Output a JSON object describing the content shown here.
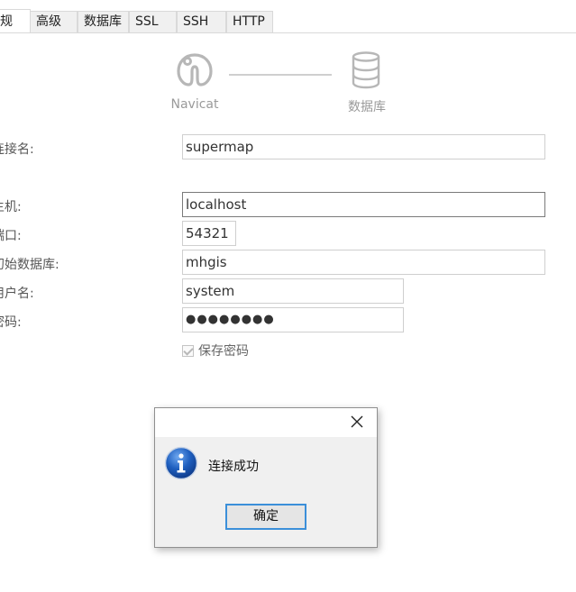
{
  "tabs": [
    {
      "label": "规"
    },
    {
      "label": "高级"
    },
    {
      "label": "数据库"
    },
    {
      "label": "SSL"
    },
    {
      "label": "SSH"
    },
    {
      "label": "HTTP"
    }
  ],
  "stepper": {
    "left_label": "Navicat",
    "right_label": "数据库"
  },
  "form": {
    "connection_name": {
      "label": "连接名:",
      "value": "supermap"
    },
    "host": {
      "label": "主机:",
      "value": "localhost"
    },
    "port": {
      "label": "端口:",
      "value": "54321"
    },
    "initial_database": {
      "label": "初始数据库:",
      "value": "mhgis"
    },
    "username": {
      "label": "用户名:",
      "value": "system"
    },
    "password": {
      "label": "密码:",
      "value": "●●●●●●●●"
    },
    "save_password": {
      "label": "保存密码",
      "checked": true
    }
  },
  "dialog": {
    "message": "连接成功",
    "ok_label": "确定",
    "icon": "info-icon"
  },
  "colors": {
    "dialog_button_border": "#3b8fd9",
    "info_icon_blue": "#1f5fbf"
  }
}
